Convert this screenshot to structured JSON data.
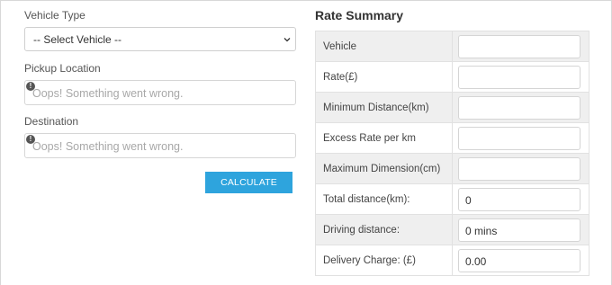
{
  "form": {
    "vehicle_type_label": "Vehicle Type",
    "vehicle_select_value": "-- Select Vehicle --",
    "pickup_label": "Pickup Location",
    "pickup_error": "Oops! Something went wrong.",
    "destination_label": "Destination",
    "destination_error": "Oops! Something went wrong.",
    "calculate_label": "CALCULATE",
    "warning_glyph": "!"
  },
  "summary": {
    "title": "Rate Summary",
    "rows": [
      {
        "label": "Vehicle",
        "value": ""
      },
      {
        "label": "Rate(£)",
        "value": ""
      },
      {
        "label": "Minimum Distance(km)",
        "value": ""
      },
      {
        "label": "Excess Rate per km",
        "value": ""
      },
      {
        "label": "Maximum Dimension(cm)",
        "value": ""
      },
      {
        "label": "Total distance(km):",
        "value": "0"
      },
      {
        "label": "Driving distance:",
        "value": "0 mins"
      },
      {
        "label": "Delivery Charge: (£)",
        "value": "0.00"
      }
    ]
  },
  "colors": {
    "button": "#2ea4dd",
    "row_shade": "#efefef"
  }
}
